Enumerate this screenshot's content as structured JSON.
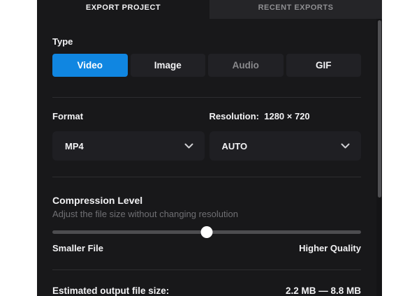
{
  "tabs": [
    {
      "label": "EXPORT PROJECT",
      "active": true
    },
    {
      "label": "RECENT EXPORTS",
      "active": false
    }
  ],
  "type_section": {
    "label": "Type",
    "options": [
      {
        "label": "Video",
        "state": "selected"
      },
      {
        "label": "Image",
        "state": "default"
      },
      {
        "label": "Audio",
        "state": "disabled"
      },
      {
        "label": "GIF",
        "state": "default"
      }
    ]
  },
  "format_section": {
    "format_label": "Format",
    "resolution_label": "Resolution:",
    "resolution_value": "1280 × 720",
    "format_dropdown": {
      "value": "MP4",
      "icon": "chevron-down-icon"
    },
    "resolution_dropdown": {
      "value": "AUTO",
      "icon": "chevron-down-icon"
    }
  },
  "compression_section": {
    "title": "Compression Level",
    "subtitle": "Adjust the file size without changing resolution",
    "slider": {
      "value_percent": 50
    },
    "left_label": "Smaller File",
    "right_label": "Higher Quality"
  },
  "estimate_section": {
    "label": "Estimated output file size:",
    "value": "2.2 MB — 8.8 MB"
  },
  "colors": {
    "accent_blue": "#1086e1",
    "panel_bg": "#18181a",
    "inactive_tab_bg": "#252528",
    "control_bg": "#212125",
    "dropdown_bg": "#1f1f23",
    "disabled_text": "#8a8a8d",
    "subtitle_text": "#707074",
    "divider": "#2d2d30",
    "slider_track": "#4d4d50",
    "slider_thumb": "#ffffff"
  }
}
